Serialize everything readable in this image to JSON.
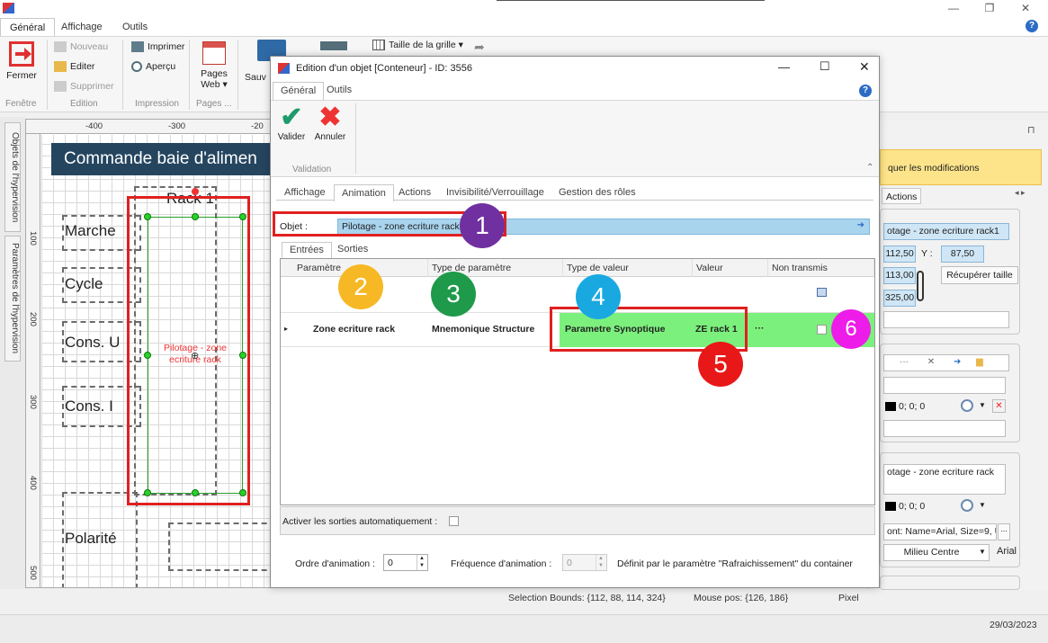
{
  "ribbon": {
    "tabs": [
      "Général",
      "Affichage",
      "Outils"
    ],
    "fermer": "Fermer",
    "nouveau": "Nouveau",
    "editer": "Editer",
    "supprimer": "Supprimer",
    "imprimer": "Imprimer",
    "apercu": "Aperçu",
    "pages_web": "Pages Web ▾",
    "sauv": "Sauv",
    "taille_grille": "Taille de la grille ▾",
    "groups": {
      "fenetre": "Fenêtre",
      "edition": "Edition",
      "impression": "Impression",
      "pages": "Pages ..."
    }
  },
  "canvas": {
    "ruler_top": [
      "-400",
      "-300",
      "-20"
    ],
    "ruler_left": [
      "100",
      "200",
      "300",
      "400",
      "500"
    ],
    "header": "Commande baie d'alimen",
    "rack_label": "Rack 1",
    "selected_text": "Pilotage - zone ecriture rack",
    "labels": [
      "Marche",
      "Cycle",
      "Cons. U",
      "Cons. I",
      "Polarité"
    ]
  },
  "side_tabs": [
    "Objets de l'hypervision",
    "Paramètres de l'hypervision"
  ],
  "dialog": {
    "title": "Edition d'un objet [Conteneur] - ID: 3556",
    "tabs": [
      "Général",
      "Outils"
    ],
    "valider": "Valider",
    "annuler": "Annuler",
    "validation_group": "Validation",
    "sub_tabs": [
      "Affichage",
      "Animation",
      "Actions",
      "Invisibilité/Verrouillage",
      "Gestion des rôles"
    ],
    "objet_label": "Objet :",
    "objet_value": "Pilotage - zone ecriture rack",
    "io_tabs": [
      "Entrées",
      "Sorties"
    ],
    "columns": [
      "Paramètre",
      "Type de paramètre",
      "Type de valeur",
      "Valeur",
      "Non transmis"
    ],
    "row": {
      "parametre": "Zone ecriture rack",
      "type_param": "Mnemonique Structure",
      "type_valeur": "Parametre Synoptique",
      "valeur": "ZE rack 1",
      "more": "···"
    },
    "auto_outputs": "Activer les sorties automatiquement :",
    "ordre_label": "Ordre d'animation :",
    "ordre_value": "0",
    "freq_label": "Fréquence d'animation :",
    "freq_value": "0",
    "freq_note": "Définit par le paramètre \"Rafraichissement\" du container"
  },
  "badges": [
    "1",
    "2",
    "3",
    "4",
    "5",
    "6"
  ],
  "right_panel": {
    "apply_btn": "quer les modifications",
    "tab_actions": "Actions",
    "name_value": "otage - zone ecriture rack1",
    "x_value": "112,50",
    "y_label": "Y :",
    "y_value": "87,50",
    "w_value": "113,00",
    "h_value": "325,00",
    "recup_btn": "Récupérer taille",
    "color1": "0; 0; 0",
    "text_value": "otage - zone ecriture rack",
    "color2": "0; 0; 0",
    "font_value": "ont: Name=Arial, Size=9, Ur",
    "align_value": "Milieu Centre",
    "font_name": "Arial"
  },
  "status": {
    "bounds": "Selection Bounds: {112, 88, 114, 324}",
    "mouse": "Mouse pos: {126, 186}",
    "unit": "Pixel"
  },
  "date": "29/03/2023"
}
